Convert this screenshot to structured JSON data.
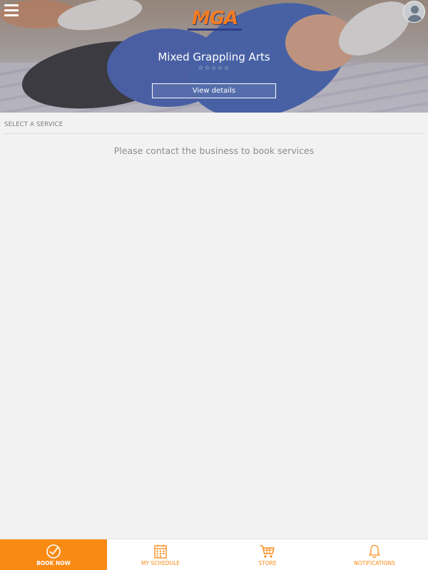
{
  "header": {
    "logo_text": "MGA",
    "logo_tagline": "MIXED GRAPPLING ARTS",
    "business_name": "Mixed Grappling Arts",
    "rating_stars": "☆☆☆☆☆",
    "view_details_label": "View details"
  },
  "services": {
    "section_title": "SELECT A SERVICE",
    "empty_message": "Please contact the business to book services"
  },
  "tabbar": {
    "items": [
      {
        "label": "BOOK NOW",
        "icon": "check-circle-icon",
        "active": true
      },
      {
        "label": "MY SCHEDULE",
        "icon": "calendar-icon",
        "active": false
      },
      {
        "label": "STORE",
        "icon": "cart-icon",
        "active": false
      },
      {
        "label": "NOTIFICATIONS",
        "icon": "bell-icon",
        "active": false
      }
    ]
  },
  "colors": {
    "accent": "#f98a14",
    "background": "#f2f2f2",
    "logo_orange": "#f47b20",
    "logo_blue": "#2f3f86"
  }
}
